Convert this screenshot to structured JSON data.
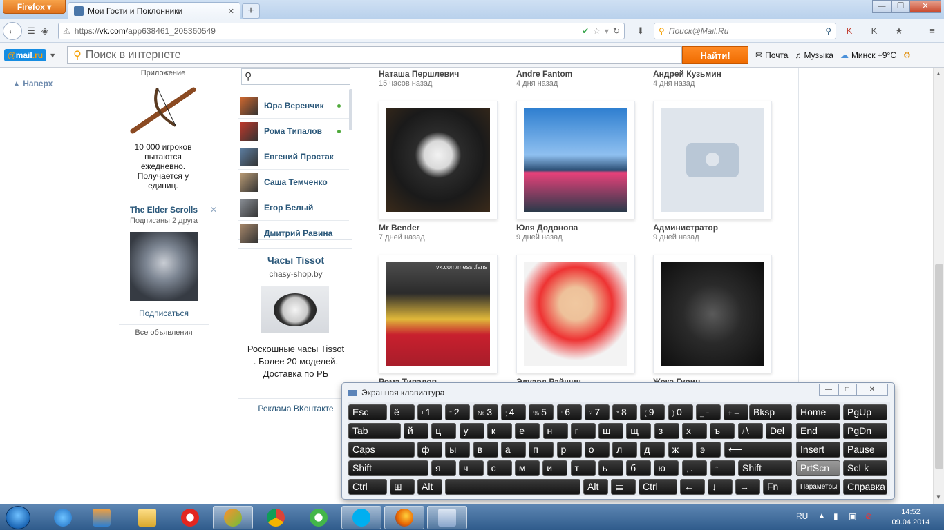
{
  "browser": {
    "menu_label": "Firefox",
    "tab_title": "Мои Гости и Поклонники",
    "new_tab": "+",
    "url_prefix": "https://",
    "url_host": "vk.com",
    "url_path": "/app638461_205360549",
    "search_placeholder": "Поиск@Mail.Ru",
    "win_minimize": "—",
    "win_restore": "❐",
    "win_close": "✕"
  },
  "mailbar": {
    "logo_at": "@",
    "logo_mail": "mail",
    "logo_ru": ".ru",
    "search_placeholder": "Поиск в интернете",
    "find_button": "Найти!",
    "mail_link": "Почта",
    "music_link": "Музыка",
    "weather_link": "Минск +9°C"
  },
  "sidebar": {
    "back_top": "Наверх",
    "app_caption": "Приложение",
    "app_desc": "10 000 игроков пытаются ежедневно. Получается у единиц.",
    "ad_title": "The Elder Scrolls",
    "ad_close": "✕",
    "ad_sub": "Подписаны 2 друга",
    "subscribe": "Подписаться",
    "all_ads": "Все объявления"
  },
  "friends": [
    {
      "name": "Юра Веренчик",
      "online": true,
      "color": "#d2692f"
    },
    {
      "name": "Рома Типалов",
      "online": true,
      "color": "#c0392b"
    },
    {
      "name": "Евгений Простак",
      "online": false,
      "color": "#5d7fa3"
    },
    {
      "name": "Саша Темченко",
      "online": false,
      "color": "#b89a74"
    },
    {
      "name": "Егор Белый",
      "online": false,
      "color": "#8a8f96"
    },
    {
      "name": "Дмитрий Равина",
      "online": false,
      "color": "#a6876a"
    }
  ],
  "tissot": {
    "title": "Часы Tissot",
    "site": "chasy-shop.by",
    "desc": "Роскошные часы Tissot . Более 20 моделей. Доставка по РБ",
    "ad_link": "Реклама ВКонтакте"
  },
  "guests_top": [
    {
      "name": "Наташа Першлевич",
      "time": "15 часов назад"
    },
    {
      "name": "Andre Fantom",
      "time": "4 дня назад"
    },
    {
      "name": "Андрей Кузьмин",
      "time": "4 дня назад"
    }
  ],
  "guests_mid": [
    {
      "name": "Mr Bender",
      "time": "7 дней назад"
    },
    {
      "name": "Юля Додонова",
      "time": "9 дней назад"
    },
    {
      "name": "Администратор",
      "time": "9 дней назад"
    }
  ],
  "guests_bottom": [
    {
      "name": "Рома Типалов"
    },
    {
      "name": "Эдуард Райшин"
    },
    {
      "name": "Жека Гурин"
    }
  ],
  "photo_watermark": "vk.com/messi.fans",
  "osk": {
    "title": "Экранная клавиатура",
    "minimize": "—",
    "restore": "□",
    "close": "✕",
    "keys": {
      "esc": "Esc",
      "yo": "ё",
      "d1": "1",
      "s1": "!",
      "d2": "2",
      "s2": "\"",
      "d3": "3",
      "s3": "№",
      "d4": "4",
      "s4": ";",
      "d5": "5",
      "s5": "%",
      "d6": "6",
      "s6": ":",
      "d7": "7",
      "s7": "?",
      "d8": "8",
      "s8": "*",
      "d9": "9",
      "s9": "(",
      "d0": "0",
      "s0": ")",
      "minus": "-",
      "sminus": "_",
      "eq": "=",
      "seq": "+",
      "bksp": "Bksp",
      "home": "Home",
      "pgup": "PgUp",
      "tab": "Tab",
      "r1": [
        "й",
        "ц",
        "у",
        "к",
        "е",
        "н",
        "г",
        "ш",
        "щ",
        "з",
        "х",
        "ъ"
      ],
      "bslash": "\\",
      "sbslash": "/",
      "del": "Del",
      "end": "End",
      "pgdn": "PgDn",
      "caps": "Caps",
      "r2": [
        "ф",
        "ы",
        "в",
        "а",
        "п",
        "р",
        "о",
        "л",
        "д",
        "ж",
        "э"
      ],
      "enter": "⟵",
      "insert": "Insert",
      "pause": "Pause",
      "shift": "Shift",
      "r3": [
        "я",
        "ч",
        "с",
        "м",
        "и",
        "т",
        "ь",
        "б",
        "ю"
      ],
      "dot": ".",
      "sdot": ",",
      "up": "↑",
      "shift_r": "Shift",
      "prtscn": "PrtScn",
      "sclk": "ScLk",
      "ctrl": "Ctrl",
      "alt": "Alt",
      "alt_r": "Alt",
      "ctrl_r": "Ctrl",
      "left": "←",
      "down": "↓",
      "right": "→",
      "fn": "Fn",
      "params": "Параметры",
      "help": "Справка"
    }
  },
  "taskbar": {
    "lang": "RU",
    "time": "14:52",
    "date": "09.04.2014"
  }
}
